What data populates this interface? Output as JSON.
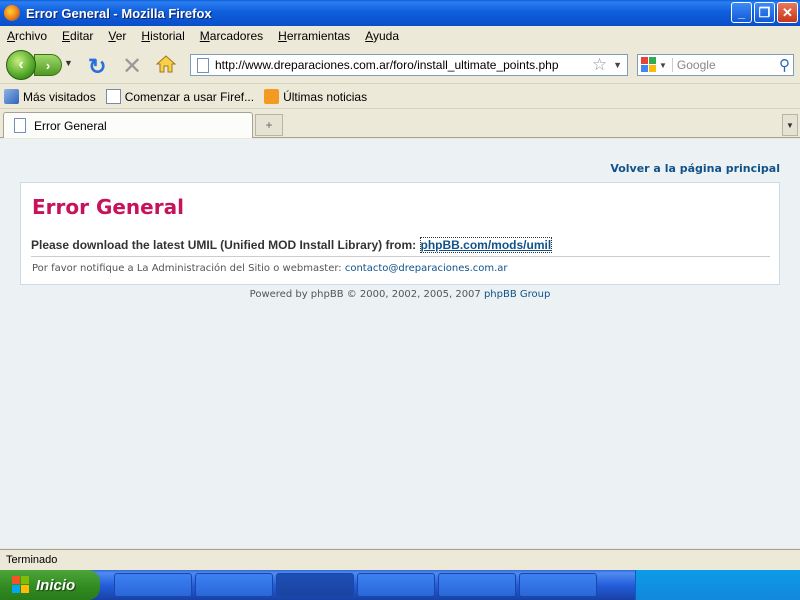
{
  "window": {
    "title": "Error General - Mozilla Firefox"
  },
  "menu": {
    "items": [
      "Archivo",
      "Editar",
      "Ver",
      "Historial",
      "Marcadores",
      "Herramientas",
      "Ayuda"
    ]
  },
  "navigation": {
    "url": "http://www.dreparaciones.com.ar/foro/install_ultimate_points.php",
    "search_placeholder": "Google"
  },
  "bookmarks": {
    "items": [
      "Más visitados",
      "Comenzar a usar Firef...",
      "Últimas noticias"
    ]
  },
  "tabs": {
    "active_label": "Error General"
  },
  "page": {
    "back_link": "Volver a la página principal",
    "heading": "Error General",
    "message": "Please download the latest UMIL (Unified MOD Install Library) from: ",
    "message_link": "phpBB.com/mods/umil",
    "notice": "Por favor notifique a La Administración del Sitio o webmaster: ",
    "notice_email": "contacto@dreparaciones.com.ar",
    "powered_prefix": "Powered by phpBB © 2000, 2002, 2005, 2007 ",
    "powered_link": "phpBB Group"
  },
  "status": {
    "text": "Terminado"
  },
  "taskbar": {
    "start_label": "Inicio"
  },
  "colors": {
    "heading": "#c6135c",
    "link": "#105289",
    "page_background": "#ecf1f3"
  }
}
